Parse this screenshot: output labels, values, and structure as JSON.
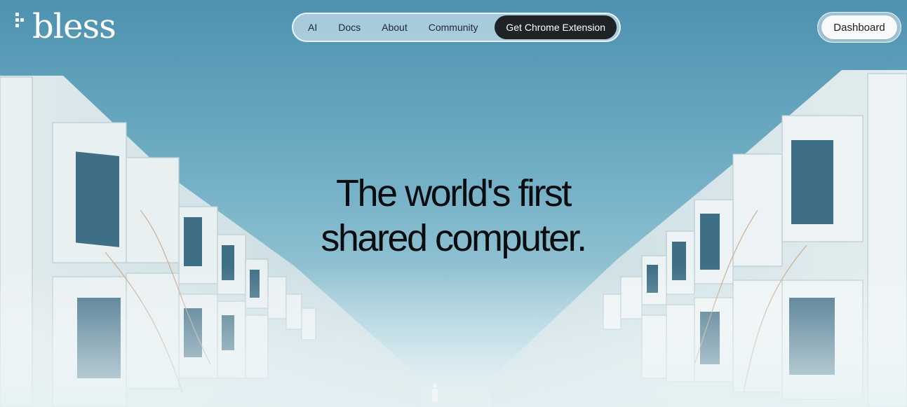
{
  "logo": {
    "text": "bless"
  },
  "nav": {
    "items": [
      {
        "label": "AI"
      },
      {
        "label": "Docs"
      },
      {
        "label": "About"
      },
      {
        "label": "Community"
      }
    ],
    "cta_label": "Get Chrome Extension"
  },
  "header": {
    "dashboard_label": "Dashboard"
  },
  "hero": {
    "headline_line1": "The world's first",
    "headline_line2": "shared computer."
  },
  "colors": {
    "sky": "#5e9fba",
    "cta_bg": "#1f2326",
    "text_dark": "#0a0d10"
  }
}
